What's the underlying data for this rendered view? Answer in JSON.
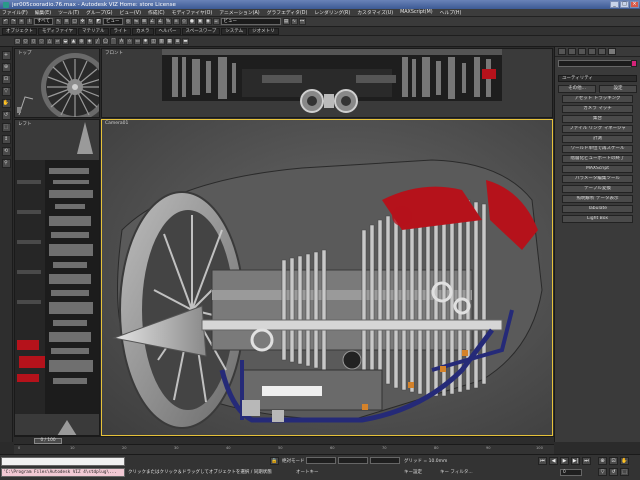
{
  "window": {
    "title": "jer005cooradio.76.max - Autodesk VIZ Home: store License",
    "icon": "app-icon"
  },
  "menu": {
    "items": [
      "ファイル(F)",
      "編集(E)",
      "ツール(T)",
      "グループ(G)",
      "ビュー(V)",
      "作成(C)",
      "モディファイヤ(O)",
      "アニメーション(A)",
      "グラフエディタ(D)",
      "レンダリング(R)",
      "カスタマイズ(U)",
      "MAXScript(M)",
      "ヘルプ(H)"
    ]
  },
  "toolbar": {
    "selection_filter": "すべて",
    "view_dropdown": "ビュー",
    "selection_set": "ビュー"
  },
  "ribbon": {
    "tabs": [
      "オブジェクト",
      "モディファイヤ",
      "マテリアル",
      "ライト",
      "カメラ",
      "ヘルパー",
      "スペースワープ",
      "システム",
      "ジオメトリ"
    ]
  },
  "viewports": {
    "top": {
      "label": "トップ"
    },
    "front": {
      "label": "フロント"
    },
    "left": {
      "label": "レフト"
    },
    "camera": {
      "label": "Camera01"
    }
  },
  "command_panel": {
    "rollout_title": "ユーティリティ",
    "more_button": "その他...",
    "sets_button": "設定",
    "buttons": [
      "アセット トラッキング",
      "カメラ マッチ",
      "集合",
      "ファイル リンク マネージャ",
      "計測",
      "ワールド単位で再スケール",
      "階層化ビューポートの終了",
      "MAXScript",
      "パラメータ編集ツール",
      "テーブル変換",
      "照明解析 データ表示",
      "Tabulate",
      "Light Box"
    ]
  },
  "timeline": {
    "slider_label": "0 / 100",
    "ticks": [
      "0",
      "10",
      "20",
      "30",
      "40",
      "50",
      "60",
      "70",
      "80",
      "90",
      "100"
    ]
  },
  "status": {
    "maxscript_line1": "",
    "maxscript_line2": "'C:\\Program Files\\Autodesk VIZ 4\\stdplug\\...",
    "prompt": "クリックまたはクリック＆ドラッグしてオブジェクトを選択 / 同期状態",
    "abs_mode": "絶対モード",
    "auto_key": "オートキー",
    "set_key": "キー設定",
    "grid_label": "グリッド = 10.0mm",
    "key_filters": "キー フィルタ...",
    "time_field": "0"
  },
  "colors": {
    "accent": "#e6c23a",
    "selection": "#d6237a",
    "engine_red": "#b5121b",
    "engine_blue": "#252a78"
  }
}
